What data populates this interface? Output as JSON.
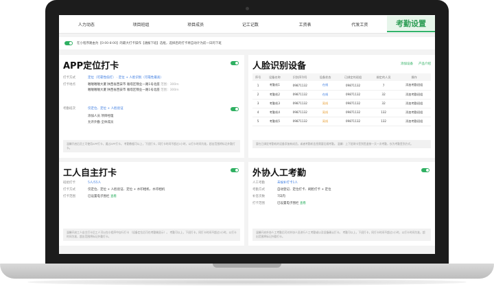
{
  "nav": {
    "items": [
      "人力动态",
      "项目班组",
      "项目成员",
      "记工记数",
      "工资表",
      "代发工资"
    ],
    "active": "考勤设置"
  },
  "notice": {
    "text": "在小程序路由为【0:00-8:00】的最大打卡操作【通报下班】选框，选择后的打卡将自动计为前一日的下班"
  },
  "app_card": {
    "title": "APP定位打卡",
    "rows": [
      {
        "label": "打卡方式",
        "value": "定位（可靠性低打）  ·  定位 + 人脸识别（可靠性最高）"
      },
      {
        "label": "打卡地点",
        "value": "喔喔喔喔大厦    陕西省西安市 雁塔区锦业一路1号北座",
        "extra": "范围：300m"
      },
      {
        "label": "",
        "value": "喔喔喔喔大厦    陕西省西安市 雁塔区锦业一路1号北座",
        "extra": "范围：300m"
      },
      {
        "label": "考勤班次",
        "value": "仅定位、定位 + 人脸验证"
      },
      {
        "label": "",
        "value": "添加人员    项目经理"
      },
      {
        "label": "",
        "value": "允许外勤    全体成员"
      }
    ],
    "note": "温馨开启后员工可使用APP打卡，通过APP打卡。 考勤数据可以上，下班打卡，同打卡时间不超过1小时，以打卡时间为准，超出范围将标记外勤打卡。"
  },
  "face_card": {
    "title": "人脸识别设备",
    "actions": [
      "添加设备",
      "产品介绍"
    ],
    "columns": [
      "序号",
      "设备名称",
      "识别序列号",
      "设备状态",
      "已绑定的班组",
      "绑定的人员",
      "操作"
    ],
    "rows": [
      {
        "no": "1",
        "name": "考勤机1",
        "sn": "09871132",
        "status": "在线",
        "group": "09871132",
        "count": "7",
        "op": "添加考勤班组"
      },
      {
        "no": "2",
        "name": "考勤机2",
        "sn": "09871132",
        "status": "在线",
        "group": "09871132",
        "count": "32",
        "op": "添加考勤班组"
      },
      {
        "no": "3",
        "name": "考勤机3",
        "sn": "09871132",
        "status": "离线",
        "group": "09871132",
        "count": "32",
        "op": "添加考勤班组"
      },
      {
        "no": "4",
        "name": "考勤机4",
        "sn": "09871132",
        "status": "离线",
        "group": "09871132",
        "count": "132",
        "op": "添加考勤班组"
      },
      {
        "no": "5",
        "name": "考勤机5",
        "sn": "09871132",
        "status": "离线",
        "group": "09871132",
        "count": "132",
        "op": "添加考勤班组"
      }
    ],
    "note": "要在已绑定考勤机的设备添加新成员，或者考勤机信息需要后缀考勤。 温馨：上下班刷卡签到签退按一天一次考勤，仅为考勤签到方式。"
  },
  "worker_card": {
    "title": "工人自主打卡",
    "rows": [
      {
        "label": "班组打卡",
        "value": "5人/55人"
      },
      {
        "label": "打卡方式",
        "value": "仅定位、定位 + 人脸验证、定位 + 水印相机、水印相机"
      },
      {
        "label": "打卡范围",
        "value": "已设置电子围栏",
        "link": "查看"
      }
    ],
    "note": "温馨开启工人自主打卡后工人可以在小程序中自行打卡 （设备定位后可在考勤端显示）。 考勤可以上，下班打卡，同打卡时间不超过1小时，以打卡时间为准，超出范围将标记外勤打卡。"
  },
  "outsource_card": {
    "title": "外协人工考勤",
    "rows": [
      {
        "label": "人工考勤",
        "value": "未候补打卡1人"
      },
      {
        "label": "考勤方式",
        "value": "自动登记、定位打卡、刷脸打卡 + 定位"
      },
      {
        "label": "补签次数",
        "value": "7日内"
      },
      {
        "label": "打卡范围",
        "value": "已设置电子围栏",
        "link": "查看"
      }
    ],
    "note": "温馨开启外协人工考勤后可对外协人员进行人工考勤或以及设备确认打卡。 考勤可以上，下班打卡，同打卡时间不超过1小时，以打卡时间为准，超出范围将标记外勤打卡。"
  },
  "colors": {
    "accent": "#2fb062",
    "link": "#3b7be0",
    "warn": "#e8a23a"
  }
}
